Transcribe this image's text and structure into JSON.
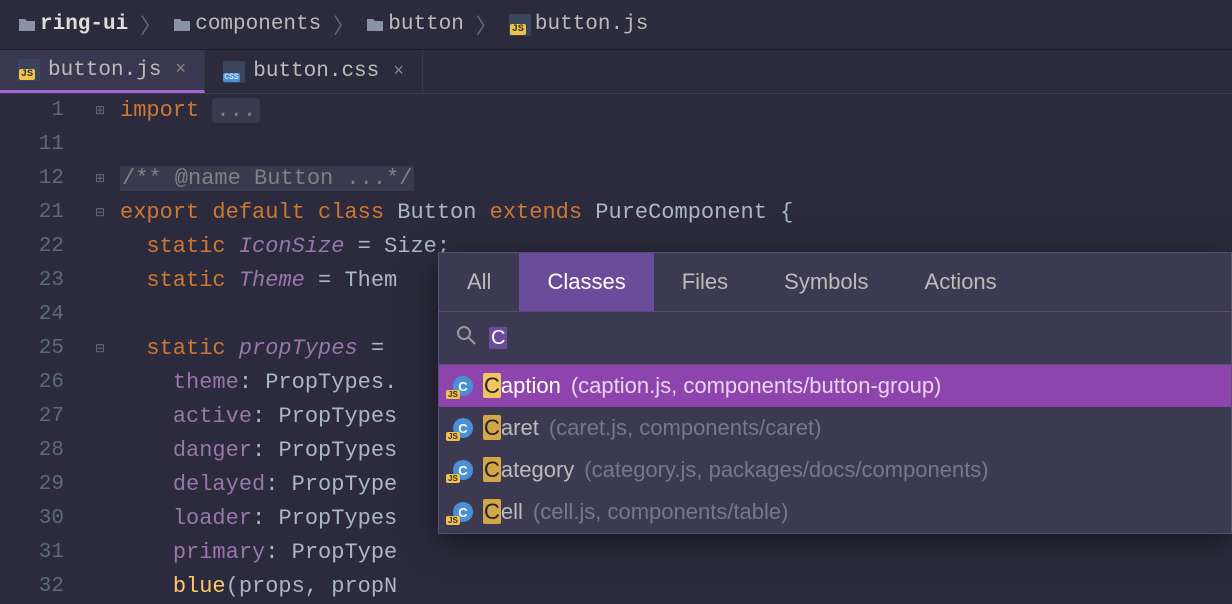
{
  "breadcrumb": [
    {
      "icon": "folder",
      "label": "ring-ui",
      "bold": true
    },
    {
      "icon": "folder",
      "label": "components"
    },
    {
      "icon": "folder",
      "label": "button"
    },
    {
      "icon": "jsfile",
      "label": "button.js"
    }
  ],
  "tabs": [
    {
      "icon": "jsfile",
      "label": "button.js",
      "active": true
    },
    {
      "icon": "cssfile",
      "label": "button.css",
      "active": false
    }
  ],
  "editor": {
    "lines": [
      {
        "num": "1",
        "fold": "+",
        "html": "<span class='tok-kw'>import</span> <span class='tok-fold'>...</span>"
      },
      {
        "num": "11",
        "fold": "",
        "html": ""
      },
      {
        "num": "12",
        "fold": "+",
        "html": "<span class='tok-comm'>/** @name Button ...*/</span>"
      },
      {
        "num": "21",
        "fold": "-",
        "html": "<span class='tok-kw'>export default class</span> <span class='tok-cls'>Button</span> <span class='tok-kw'>extends</span> <span class='tok-cls'>PureComponent</span> <span class='tok-punc'>{</span>"
      },
      {
        "num": "22",
        "fold": "",
        "html": "  <span class='tok-kw'>static</span> <span class='tok-ital'>IconSize</span> <span class='tok-punc'>=</span> <span class='tok-cls'>Size</span><span class='tok-punc'>;</span>"
      },
      {
        "num": "23",
        "fold": "",
        "html": "  <span class='tok-kw'>static</span> <span class='tok-ital'>Theme</span> <span class='tok-punc'>=</span> <span class='tok-cls'>Them</span>"
      },
      {
        "num": "24",
        "fold": "",
        "html": ""
      },
      {
        "num": "25",
        "fold": "-",
        "html": "  <span class='tok-kw'>static</span> <span class='tok-ital'>propTypes</span> <span class='tok-punc'>=</span> "
      },
      {
        "num": "26",
        "fold": "",
        "html": "    <span class='tok-field'>theme</span><span class='tok-punc'>:</span> <span class='tok-cls'>PropTypes</span><span class='tok-punc'>.</span>"
      },
      {
        "num": "27",
        "fold": "",
        "html": "    <span class='tok-field'>active</span><span class='tok-punc'>:</span> <span class='tok-cls'>PropTypes</span>"
      },
      {
        "num": "28",
        "fold": "",
        "html": "    <span class='tok-field'>danger</span><span class='tok-punc'>:</span> <span class='tok-cls'>PropTypes</span>"
      },
      {
        "num": "29",
        "fold": "",
        "html": "    <span class='tok-field'>delayed</span><span class='tok-punc'>:</span> <span class='tok-cls'>PropType</span>"
      },
      {
        "num": "30",
        "fold": "",
        "html": "    <span class='tok-field'>loader</span><span class='tok-punc'>:</span> <span class='tok-cls'>PropTypes</span>"
      },
      {
        "num": "31",
        "fold": "",
        "html": "    <span class='tok-field'>primary</span><span class='tok-punc'>:</span> <span class='tok-cls'>PropType</span>"
      },
      {
        "num": "32",
        "fold": "",
        "html": "    <span class='tok-method'>blue</span><span class='tok-punc'>(</span><span class='tok-cls'>props</span><span class='tok-punc'>,</span> <span class='tok-cls'>propN</span>"
      }
    ]
  },
  "popup": {
    "tabs": [
      {
        "label": "All"
      },
      {
        "label": "Classes",
        "active": true
      },
      {
        "label": "Files"
      },
      {
        "label": "Symbols"
      },
      {
        "label": "Actions"
      }
    ],
    "search_value": "C",
    "results": [
      {
        "name": "Caption",
        "path": "(caption.js, components/button-group)",
        "selected": true
      },
      {
        "name": "Caret",
        "path": "(caret.js, components/caret)"
      },
      {
        "name": "Category",
        "path": "(category.js, packages/docs/components)"
      },
      {
        "name": "Cell",
        "path": "(cell.js, components/table)"
      }
    ]
  }
}
